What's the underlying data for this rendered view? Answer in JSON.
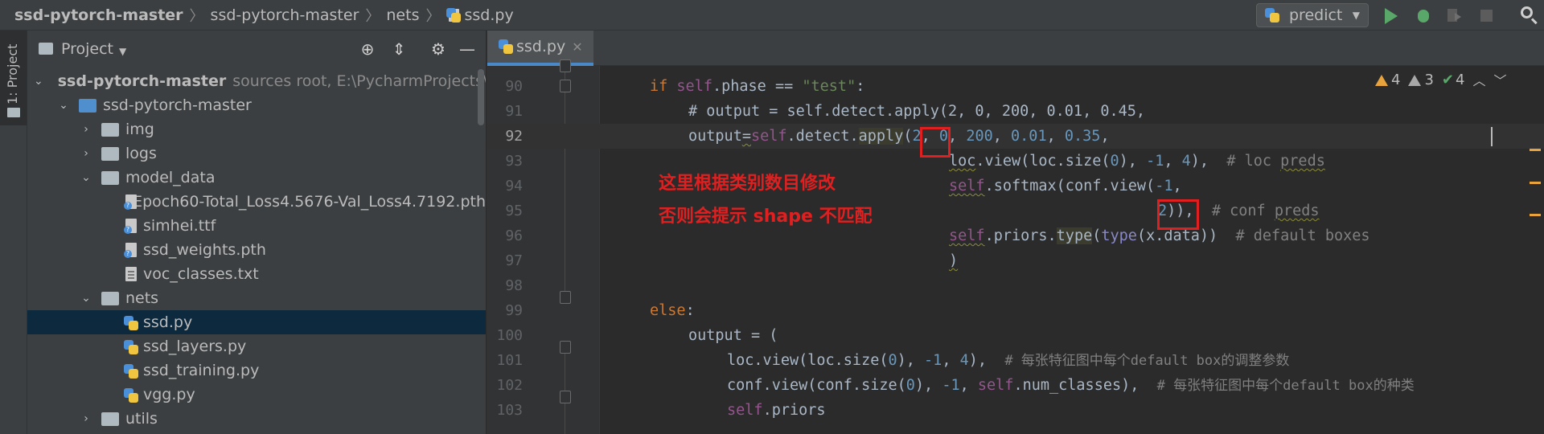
{
  "breadcrumb": {
    "items": [
      "ssd-pytorch-master",
      "ssd-pytorch-master",
      "nets",
      "ssd.py"
    ]
  },
  "toolbar": {
    "run_config": "predict"
  },
  "toolstrip": {
    "project_tab": "1: Project"
  },
  "project_panel": {
    "title": "Project",
    "tree": [
      {
        "name": "ssd-pytorch-master",
        "hint": "sources root,  E:\\PycharmProjects\\ssd",
        "type": "root"
      },
      {
        "name": "ssd-pytorch-master",
        "type": "root-folder"
      },
      {
        "name": "img",
        "type": "folder"
      },
      {
        "name": "logs",
        "type": "folder"
      },
      {
        "name": "model_data",
        "type": "folder"
      },
      {
        "name": "Epoch60-Total_Loss4.5676-Val_Loss4.7192.pth",
        "type": "unknown-file"
      },
      {
        "name": "simhei.ttf",
        "type": "unknown-file"
      },
      {
        "name": "ssd_weights.pth",
        "type": "unknown-file"
      },
      {
        "name": "voc_classes.txt",
        "type": "text-file"
      },
      {
        "name": "nets",
        "type": "folder"
      },
      {
        "name": "ssd.py",
        "type": "python-file",
        "selected": true
      },
      {
        "name": "ssd_layers.py",
        "type": "python-file"
      },
      {
        "name": "ssd_training.py",
        "type": "python-file"
      },
      {
        "name": "vgg.py",
        "type": "python-file"
      },
      {
        "name": "utils",
        "type": "folder"
      }
    ]
  },
  "editor": {
    "tab_label": "ssd.py",
    "inspections": {
      "warnings": "4",
      "weak_warnings": "3",
      "typos": "4"
    },
    "line_numbers": [
      "90",
      "91",
      "92",
      "93",
      "94",
      "95",
      "96",
      "97",
      "98",
      "99",
      "100",
      "101",
      "102",
      "103"
    ],
    "code": {
      "l90_if": "if",
      "l90_self": "self",
      "l90_mid": ".phase == ",
      "l90_str": "\"test\"",
      "l90_end": ":",
      "l91": "# output = self.detect.apply(2, 0, 200, 0.01, 0.45,",
      "l92_a": "output",
      "l92_b": "=",
      "l92_self": "self",
      "l92_c": ".detect.",
      "l92_apply": "apply",
      "l92_d": "(",
      "l92_n1": "2",
      "l92_e": ", ",
      "l92_n2": "0",
      "l92_n3": "200",
      "l92_n4": "0.01",
      "l92_n5": "0.35",
      "l93_loc": "loc",
      "l93_a": ".view(loc.size(",
      "l93_n0": "0",
      "l93_b": "), ",
      "l93_n1": "-1",
      "l93_n4": "4",
      "l93_c": "),  ",
      "l93_cmt": "# loc ",
      "l93_preds": "preds",
      "l94_self": "self",
      "l94_a": ".softmax(conf.view(",
      "l94_n": "-1",
      "l94_b": ",",
      "l95_n": "2",
      "l95_a": ")),  ",
      "l95_cmt": "# conf ",
      "l95_preds": "preds",
      "l96_self": "self",
      "l96_a": ".priors.",
      "l96_type": "type",
      "l96_b": "(",
      "l96_type2": "type",
      "l96_c": "(x.data))  ",
      "l96_cmt": "# default boxes",
      "l97": ")",
      "l99_else": "else",
      "l99_colon": ":",
      "l100": "output = (",
      "l101_a": "loc.view(loc.size(",
      "l101_n0": "0",
      "l101_b": "), ",
      "l101_n1": "-1",
      "l101_n4": "4",
      "l101_c": "),  ",
      "l101_cmt": "# 每张特征图中每个default box的调整参数",
      "l102_a": "conf.view(conf.size(",
      "l102_n0": "0",
      "l102_b": "), ",
      "l102_n1": "-1",
      "l102_self": "self",
      "l102_c": ".num_classes),  ",
      "l102_cmt": "# 每张特征图中每个default box的种类",
      "l103_self": "self",
      "l103_a": ".priors"
    }
  },
  "annotations": {
    "note_line1": "这里根据类别数目修改",
    "note_line2": "否则会提示 shape 不匹配",
    "color": "#e02020"
  }
}
